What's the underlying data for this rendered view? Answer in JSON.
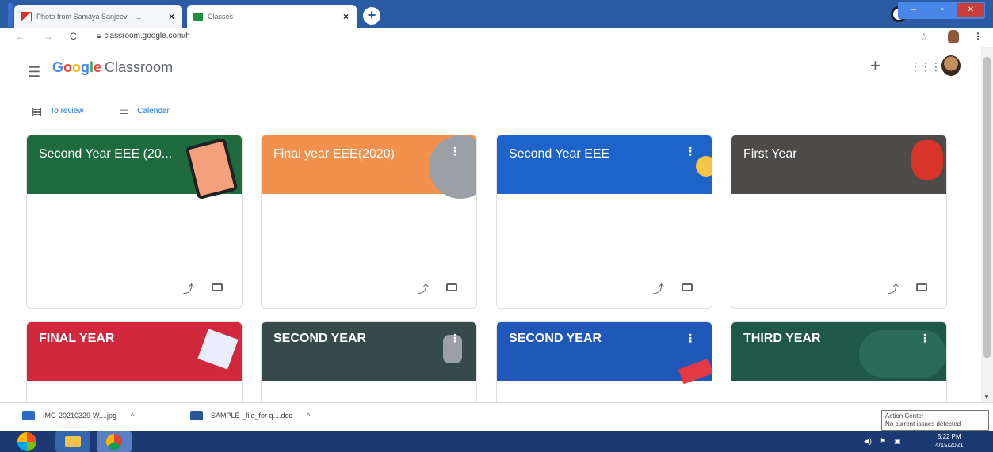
{
  "browser": {
    "tabs": [
      {
        "title": "Photo from Samaya Sanjeevi - ...",
        "close": "×"
      },
      {
        "title": "Classes",
        "close": "×"
      }
    ],
    "new_tab": "+",
    "url": "classroom.google.com/h",
    "window_controls": {
      "minimize": "–",
      "maximize": "▫",
      "close": "✕"
    }
  },
  "app": {
    "brand": "Google",
    "brand_suffix": "Classroom",
    "brand_colors": [
      "#4285f4",
      "#ea4335",
      "#fbbc05",
      "#4285f4",
      "#34a853",
      "#ea4335"
    ],
    "header_icons": [
      "menu-icon",
      "plus-icon",
      "apps-icon",
      "avatar"
    ],
    "plus_glyph": "+",
    "apps_glyph": "⋮⋮⋮"
  },
  "quick_links": [
    {
      "label": "To review",
      "icon": "review-icon"
    },
    {
      "label": "Calendar",
      "icon": "calendar-icon"
    }
  ],
  "classes": [
    {
      "name": "Second Year EEE (20...",
      "color": "#1e6b40"
    },
    {
      "name": "Final year EEE(2020)",
      "color": "#f2914e"
    },
    {
      "name": "Second Year EEE",
      "color": "#1e63c9"
    },
    {
      "name": "First Year",
      "color": "#4d4b49"
    },
    {
      "name": "FINAL YEAR",
      "color": "#d2283c"
    },
    {
      "name": "SECOND YEAR",
      "color": "#374a4a"
    },
    {
      "name": "SECOND YEAR",
      "color": "#1f58b8"
    },
    {
      "name": "THIRD YEAR",
      "color": "#1f5749"
    }
  ],
  "card_icons": {
    "more": "⋮",
    "trend": "⤴",
    "folder": "folder-icon"
  },
  "downloads": [
    {
      "name": "IMG-20210329-W....jpg",
      "chevron": "^"
    },
    {
      "name": "SAMPLE _file_for q....doc",
      "chevron": "^"
    }
  ],
  "action_center": {
    "title": "Action Center",
    "message": "No current issues detected"
  },
  "taskbar": {
    "time": "5:22 PM",
    "date": "4/15/2021"
  }
}
